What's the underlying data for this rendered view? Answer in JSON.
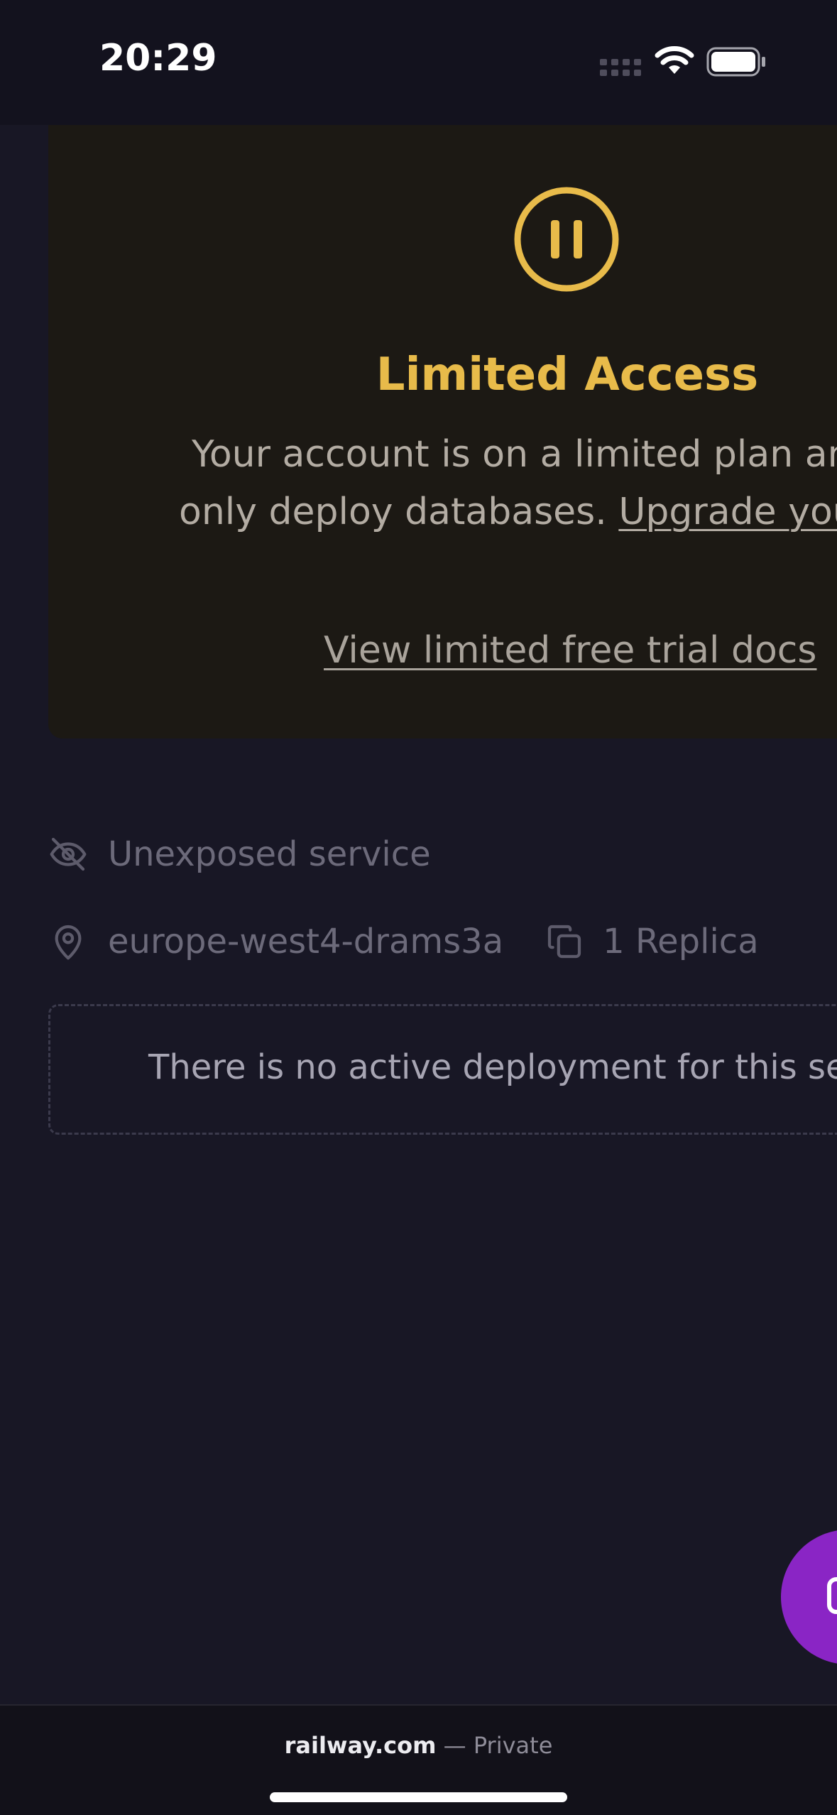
{
  "status_bar": {
    "time": "20:29"
  },
  "limited_access": {
    "title": "Limited Access",
    "message_line1": "Your account is on a limited plan and can",
    "message_line2_prefix": "only deploy databases.",
    "upgrade_link": "Upgrade your plan",
    "docs_link": "View limited free trial docs",
    "accent_color": "#e8bb4a"
  },
  "service_info": {
    "exposure": "Unexposed service",
    "region": "europe-west4-drams3a",
    "replicas": "1 Replica"
  },
  "deployment": {
    "empty_message": "There is no active deployment for this service"
  },
  "fab": {
    "color": "#8a25c5"
  },
  "browser": {
    "domain": "railway.com",
    "privacy": "— Private"
  },
  "icons": {
    "pause": "pause-circle-icon",
    "exposure": "eye-off-icon",
    "region": "map-pin-icon",
    "replicas": "copy-icon",
    "fab": "chat-icon"
  }
}
